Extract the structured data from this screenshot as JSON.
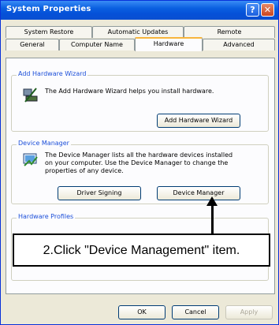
{
  "window": {
    "title": "System Properties",
    "help_glyph": "?",
    "close_glyph": "✕"
  },
  "tabs": {
    "row1": [
      "System Restore",
      "Automatic Updates",
      "Remote"
    ],
    "row2": [
      "General",
      "Computer Name",
      "Hardware",
      "Advanced"
    ],
    "active": "Hardware"
  },
  "add_hardware": {
    "group_title": "Add Hardware Wizard",
    "description": "The Add Hardware Wizard helps you install hardware.",
    "button": "Add Hardware Wizard",
    "icon": "hardware-wizard-icon"
  },
  "device_manager": {
    "group_title": "Device Manager",
    "description_line1": "The Device Manager lists all the hardware devices installed",
    "description_line2": "on your computer. Use the Device Manager to change the",
    "description_line3": "properties of any device.",
    "driver_button": "Driver Signing",
    "device_button": "Device Manager",
    "icon": "device-manager-icon"
  },
  "hardware_profiles": {
    "group_title": "Hardware Profiles"
  },
  "callout": {
    "text": "2.Click \"Device Management\"  item."
  },
  "footer": {
    "ok": "OK",
    "cancel": "Cancel",
    "apply": "Apply"
  },
  "colors": {
    "titlebar": "#0a5fe0",
    "group_label": "#1c4fd9",
    "tab_highlight": "#f7b53c"
  }
}
